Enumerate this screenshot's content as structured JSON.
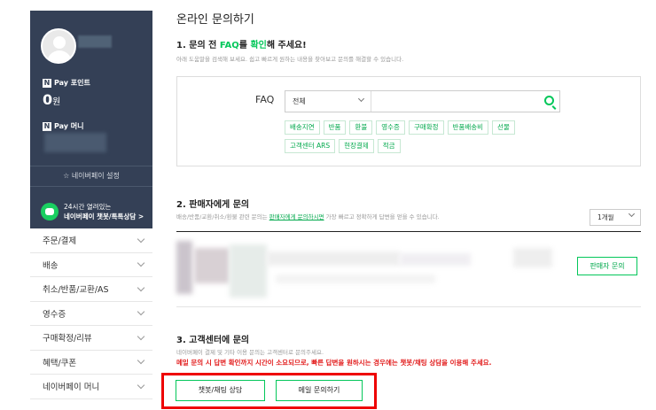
{
  "sidebar": {
    "point_label": "Pay 포인트",
    "point_value": "0",
    "point_unit": "원",
    "money_label": "Pay 머니",
    "settings_label": "☆ 네이버페이 설정",
    "chatbot_line1": "24시간 열려있는",
    "chatbot_line2": "네이버페이 챗봇/톡톡상담 >",
    "menu": [
      {
        "label": "주문/결제"
      },
      {
        "label": "배송"
      },
      {
        "label": "취소/반품/교환/AS"
      },
      {
        "label": "영수증"
      },
      {
        "label": "구매확정/리뷰"
      },
      {
        "label": "혜택/쿠폰"
      },
      {
        "label": "네이버페이 머니"
      }
    ]
  },
  "main": {
    "page_title": "온라인 문의하기",
    "sec1": {
      "title_pre": "1. 문의 전 ",
      "title_faq": "FAQ",
      "title_mid": "를 ",
      "title_check": "확인",
      "title_post": "해 주세요!",
      "desc": "아래 도움말을 검색해 보세요. 쉽고 빠르게 원하는 내용을 찾아보고 문의를 해결할 수 있습니다."
    },
    "faq": {
      "label": "FAQ",
      "select_value": "전체",
      "chips": [
        "배송지연",
        "반품",
        "환불",
        "영수증",
        "구매확정",
        "반품배송비",
        "선물",
        "고객센터 ARS",
        "현장결제",
        "적금"
      ]
    },
    "sec2": {
      "title": "2. 판매자에게 문의",
      "desc_pre": "배송/반품/교환/취소/환불 관련 문의는 ",
      "desc_link": "판매자에게 문의하시면",
      "desc_post": " 가장 빠르고 정확하게 답변을 얻을 수 있습니다.",
      "period": "1개월",
      "seller_button": "판매자 문의"
    },
    "sec3": {
      "title": "3. 고객센터에 문의",
      "desc": "네이버페이 결제 및 기타 이용 문의는 고객센터로 문의주세요.",
      "warning": "메일 문의 시 답변 확인까지 시간이 소요되므로, 빠른 답변을 원하시는 경우에는 챗봇/채팅 상담을 이용해 주세요.",
      "chat_button": "챗봇/채팅 상담",
      "mail_button": "메일 문의하기"
    }
  },
  "colors": {
    "accent": "#03c75a",
    "sidebar_bg": "#344056",
    "warning": "#e21b1b",
    "highlight": "#ee0000"
  }
}
